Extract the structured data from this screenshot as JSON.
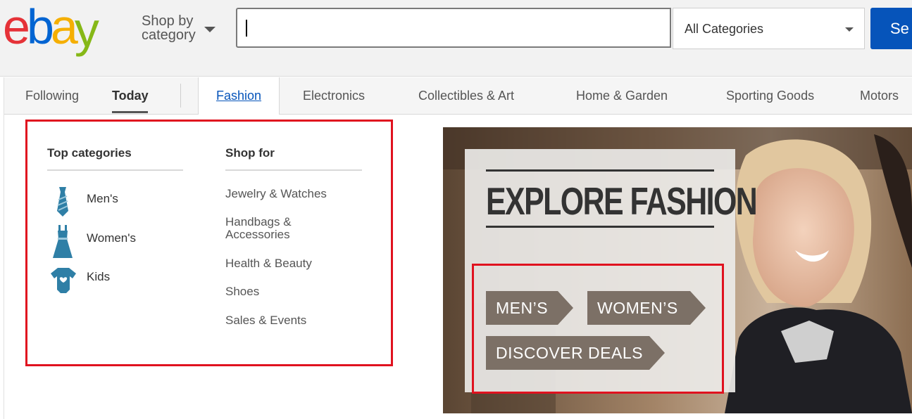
{
  "header": {
    "logo": {
      "e": "e",
      "b": "b",
      "a": "a",
      "y": "y"
    },
    "logo_colors": {
      "e": "#e53238",
      "b": "#0064d2",
      "a": "#f5af02",
      "y": "#86b817"
    },
    "shop_by_line1": "Shop by",
    "shop_by_line2": "category",
    "search_value": "",
    "category_select": "All Categories",
    "search_button": "Se"
  },
  "nav": {
    "following": "Following",
    "today": "Today",
    "tabs": [
      "Fashion",
      "Electronics",
      "Collectibles & Art",
      "Home & Garden",
      "Sporting Goods",
      "Motors"
    ]
  },
  "menu": {
    "top_categories_title": "Top categories",
    "top_categories": [
      {
        "label": "Men's",
        "icon": "tie-icon"
      },
      {
        "label": "Women's",
        "icon": "dress-icon"
      },
      {
        "label": "Kids",
        "icon": "onesie-icon"
      }
    ],
    "shop_for_title": "Shop for",
    "shop_for": [
      "Jewelry & Watches",
      "Handbags & Accessories",
      "Health & Beauty",
      "Shoes",
      "Sales & Events"
    ],
    "shop_for_line2": "Accessories",
    "shop_for_handbags_line1": "Handbags &"
  },
  "banner": {
    "headline": "EXPLORE FASHION",
    "buttons": [
      "MEN’S",
      "WOMEN’S",
      "DISCOVER DEALS"
    ]
  },
  "colors": {
    "accent": "#0654ba",
    "highlight": "#e0121f",
    "tag": "#7c7066",
    "icon": "#2f7fa6"
  }
}
